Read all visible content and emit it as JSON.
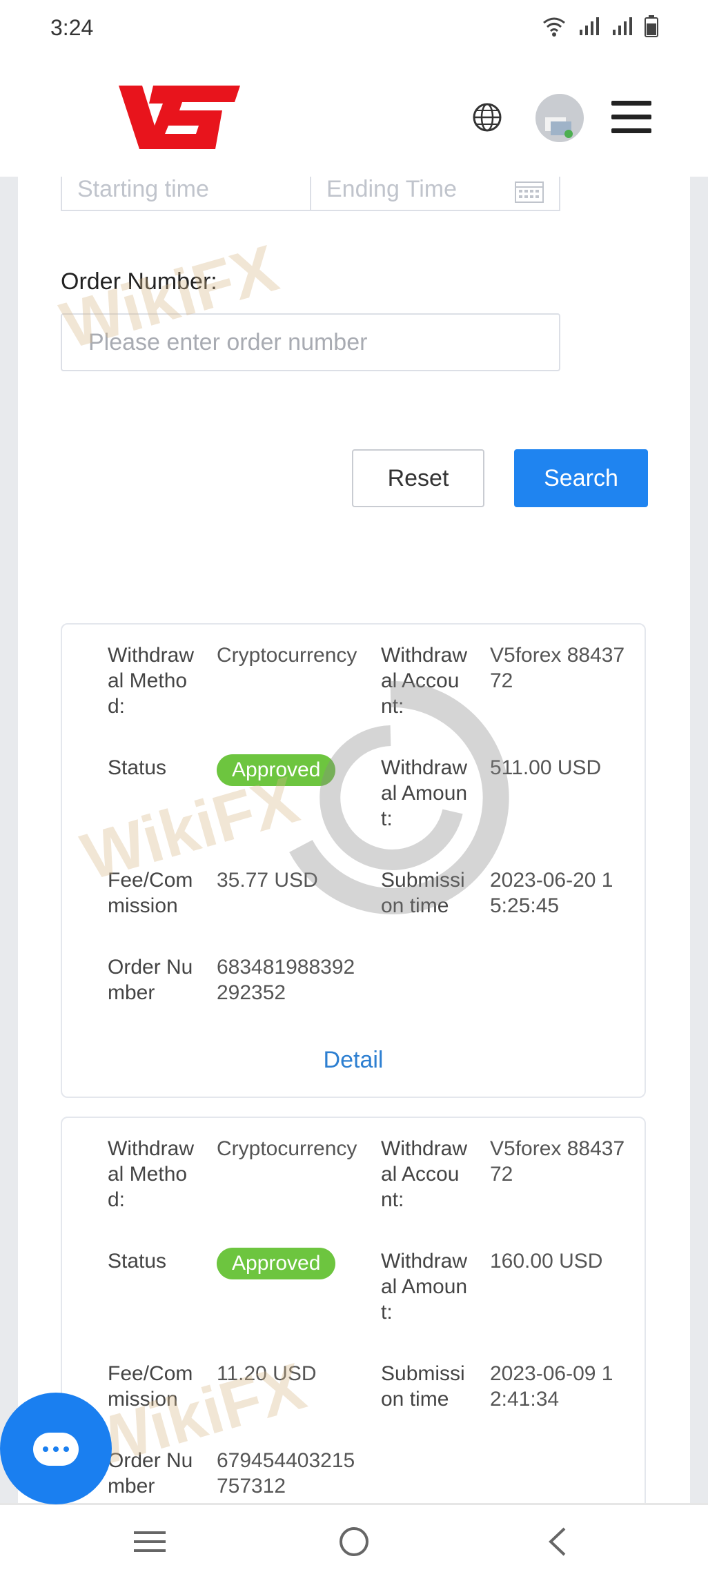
{
  "status_bar": {
    "time": "3:24"
  },
  "header": {
    "logo_text": "V5"
  },
  "filters": {
    "start_placeholder": "Starting time",
    "end_placeholder": "Ending Time",
    "order_label": "Order Number:",
    "order_placeholder": "Please enter order number",
    "reset_label": "Reset",
    "search_label": "Search"
  },
  "records": [
    {
      "method_label": "Withdrawal Method:",
      "method_value": "Cryptocurrency",
      "account_label": "Withdrawal Account:",
      "account_value": "V5forex 8843772",
      "status_label": "Status",
      "status_value": "Approved",
      "amount_label": "Withdrawal Amount:",
      "amount_value": "511.00 USD",
      "fee_label": "Fee/Commission",
      "fee_value": "35.77 USD",
      "time_label": "Submission time",
      "time_value": "2023-06-20 15:25:45",
      "order_label": "Order Number",
      "order_value": "683481988392292352",
      "detail_label": "Detail"
    },
    {
      "method_label": "Withdrawal Method:",
      "method_value": "Cryptocurrency",
      "account_label": "Withdrawal Account:",
      "account_value": "V5forex 8843772",
      "status_label": "Status",
      "status_value": "Approved",
      "amount_label": "Withdrawal Amount:",
      "amount_value": "160.00 USD",
      "fee_label": "Fee/Commission",
      "fee_value": "11.20 USD",
      "time_label": "Submission time",
      "time_value": "2023-06-09 12:41:34",
      "order_label": "Order Number",
      "order_value": "679454403215757312"
    }
  ],
  "watermark": "WikiFX",
  "colors": {
    "primary": "#1f84f0",
    "approved": "#6dc53f",
    "link": "#2d7fd1",
    "logo": "#e8141c"
  }
}
